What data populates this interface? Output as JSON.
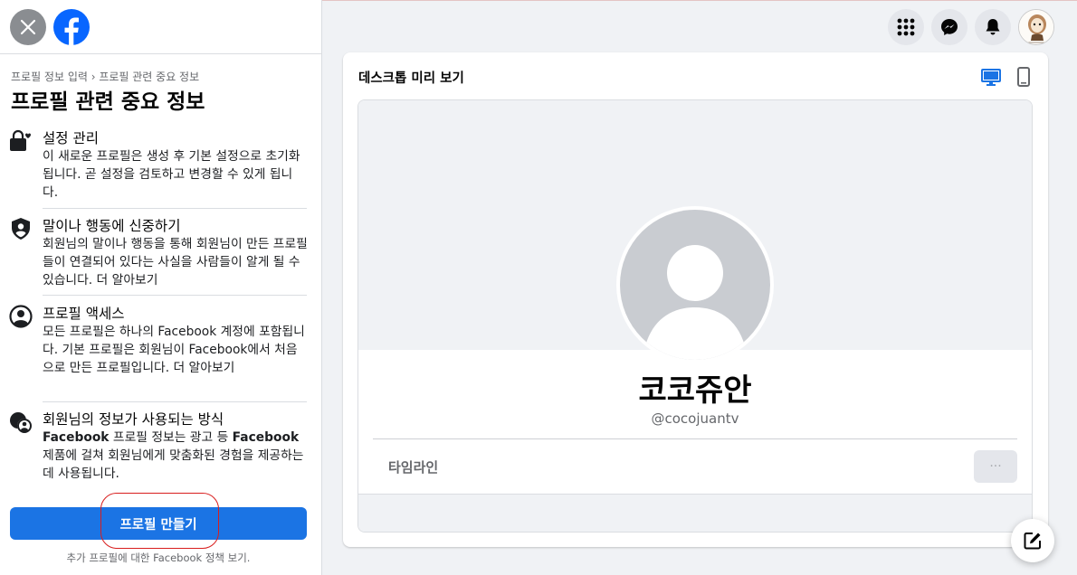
{
  "header": {
    "close_icon": "close-icon",
    "logo_icon": "facebook-logo"
  },
  "sidebar": {
    "breadcrumb": "프로필 정보 입력 › 프로필 관련 중요 정보",
    "title": "프로필 관련 중요 정보",
    "items": [
      {
        "icon": "lock-heart-icon",
        "title": "설정 관리",
        "text": "이 새로운 프로필은 생성 후 기본 설정으로 초기화됩니다. 곧 설정을 검토하고 변경할 수 있게 됩니다."
      },
      {
        "icon": "shield-person-icon",
        "title": "말이나 행동에 신중하기",
        "text": "회원님의 말이나 행동을 통해 회원님이 만든 프로필들이 연결되어 있다는 사실을 사람들이 알게 될 수 있습니다. 더 알아보기"
      },
      {
        "icon": "user-circle-icon",
        "title": "프로필 액세스",
        "text": "모든 프로필은 하나의 Facebook 계정에 포함됩니다. 기본 프로필은 회원님이 Facebook에서 처음으로 만든 프로필입니다. 더 알아보기"
      },
      {
        "icon": "profile-data-icon",
        "title": "회원님의 정보가 사용되는 방식",
        "text_parts": [
          "Facebook",
          " 프로필 정보는 광고 등 ",
          "Facebook",
          " 제품에 걸쳐 회원님에게 맞춤화된 경험을 제공하는 데 사용됩니다."
        ]
      }
    ],
    "create_button": "프로필 만들기",
    "footer_note": "추가 프로필에 대한 Facebook 정책 보기."
  },
  "topbar": {
    "icons": [
      "menu-grid-icon",
      "messenger-icon",
      "notification-bell-icon",
      "account-avatar"
    ]
  },
  "preview": {
    "title": "데스크톱 미리 보기",
    "device_icons": [
      "desktop-icon",
      "mobile-icon"
    ],
    "profile_name": "코코쥬안",
    "profile_handle": "@cocojuantv",
    "tab_timeline": "타임라인",
    "more_button": "···"
  },
  "colors": {
    "primary": "#1b74e4",
    "facebook_logo": "#0866ff",
    "background": "#f0f2f5",
    "highlight_outline": "#d81e1e"
  }
}
